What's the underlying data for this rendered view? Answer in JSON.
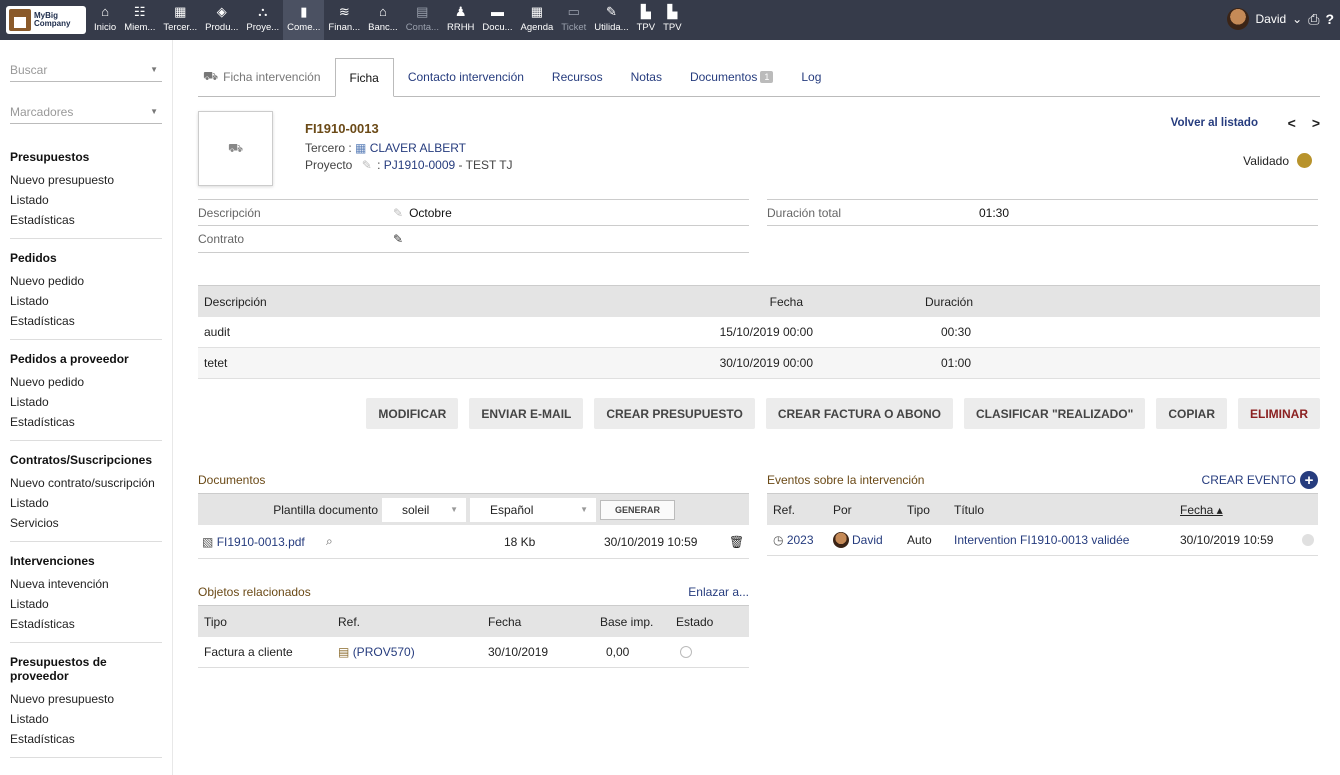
{
  "logo": {
    "line1": "MyBig",
    "line2": "Company"
  },
  "menu": [
    {
      "label": "Inicio",
      "icon": "⌂"
    },
    {
      "label": "Miem...",
      "icon": "☷"
    },
    {
      "label": "Tercer...",
      "icon": "▦"
    },
    {
      "label": "Produ...",
      "icon": "◈"
    },
    {
      "label": "Proye...",
      "icon": "⛬"
    },
    {
      "label": "Come...",
      "icon": "▮"
    },
    {
      "label": "Finan...",
      "icon": "≋"
    },
    {
      "label": "Banc...",
      "icon": "⌂"
    },
    {
      "label": "Conta...",
      "icon": "▤"
    },
    {
      "label": "RRHH",
      "icon": "♟"
    },
    {
      "label": "Docu...",
      "icon": "▬"
    },
    {
      "label": "Agenda",
      "icon": "▦"
    },
    {
      "label": "Ticket",
      "icon": "▭"
    },
    {
      "label": "Utilida...",
      "icon": "✎"
    },
    {
      "label": "TPV",
      "icon": "▙"
    },
    {
      "label": "TPV",
      "icon": "▙"
    }
  ],
  "user": {
    "name": "David",
    "caret": "⌄",
    "print_icon": "⎙",
    "help_icon": "?"
  },
  "left": {
    "search_placeholder": "Buscar",
    "bookmarks_placeholder": "Marcadores",
    "blocks": [
      {
        "title": "Presupuestos",
        "items": [
          "Nuevo presupuesto",
          "Listado",
          "Estadísticas"
        ]
      },
      {
        "title": "Pedidos",
        "items": [
          "Nuevo pedido",
          "Listado",
          "Estadísticas"
        ]
      },
      {
        "title": "Pedidos a proveedor",
        "items": [
          "Nuevo pedido",
          "Listado",
          "Estadísticas"
        ]
      },
      {
        "title": "Contratos/Suscripciones",
        "items": [
          "Nuevo contrato/suscripción",
          "Listado",
          "Servicios"
        ]
      },
      {
        "title": "Intervenciones",
        "items": [
          "Nueva intevención",
          "Listado",
          "Estadísticas"
        ]
      },
      {
        "title": "Presupuestos de proveedor",
        "items": [
          "Nuevo presupuesto",
          "Listado",
          "Estadísticas"
        ]
      }
    ]
  },
  "tabs": {
    "t0": "Ficha intervención",
    "t1": "Ficha",
    "t2": "Contacto intervención",
    "t3": "Recursos",
    "t4": "Notas",
    "t5": "Documentos",
    "t5_badge": "1",
    "t6": "Log"
  },
  "header": {
    "ref": "FI1910-0013",
    "tercero_label": "Tercero :",
    "tercero_value": "CLAVER ALBERT",
    "proyecto_label": "Proyecto",
    "proyecto_sep": ":",
    "proyecto_ref": "PJ1910-0009",
    "proyecto_name": "- TEST TJ",
    "back": "Volver al listado",
    "prev": "<",
    "next": ">",
    "status": "Validado"
  },
  "fields": {
    "descripcion_label": "Descripción",
    "descripcion_value": "Octobre",
    "contrato_label": "Contrato",
    "duracion_label": "Duración total",
    "duracion_value": "01:30"
  },
  "lines": {
    "headers": [
      "Descripción",
      "Fecha",
      "Duración"
    ],
    "rows": [
      {
        "desc": "audit",
        "fecha": "15/10/2019 00:00",
        "dur": "00:30"
      },
      {
        "desc": "tetet",
        "fecha": "30/10/2019 00:00",
        "dur": "01:00"
      }
    ]
  },
  "buttons": {
    "modificar": "MODIFICAR",
    "email": "ENVIAR E-MAIL",
    "presupuesto": "CREAR PRESUPUESTO",
    "factura": "CREAR FACTURA O ABONO",
    "realizado": "CLASIFICAR \"REALIZADO\"",
    "copiar": "COPIAR",
    "eliminar": "ELIMINAR"
  },
  "documents": {
    "title": "Documentos",
    "template_label": "Plantilla documento",
    "template_value": "soleil",
    "lang_value": "Español",
    "generate": "GENERAR",
    "file": {
      "name": "FI1910-0013.pdf",
      "size": "18 Kb",
      "date": "30/10/2019 10:59"
    }
  },
  "related": {
    "title": "Objetos relacionados",
    "link": "Enlazar a...",
    "headers": [
      "Tipo",
      "Ref.",
      "Fecha",
      "Base imp.",
      "Estado"
    ],
    "rows": [
      {
        "tipo": "Factura a cliente",
        "ref": "(PROV570)",
        "fecha": "30/10/2019",
        "base": "0,00"
      }
    ]
  },
  "events": {
    "title": "Eventos sobre la intervención",
    "create": "CREAR EVENTO",
    "headers": [
      "Ref.",
      "Por",
      "Tipo",
      "Título",
      "Fecha ▴"
    ],
    "rows": [
      {
        "ref": "2023",
        "por": "David",
        "tipo": "Auto",
        "titulo": "Intervention FI1910-0013 validée",
        "fecha": "30/10/2019 10:59"
      }
    ]
  },
  "colors": {
    "topbar": "#363b4a",
    "link": "#263c7e",
    "status_validated": "#b8932c",
    "title_brown": "#6b4a17",
    "delete": "#8b2121"
  }
}
